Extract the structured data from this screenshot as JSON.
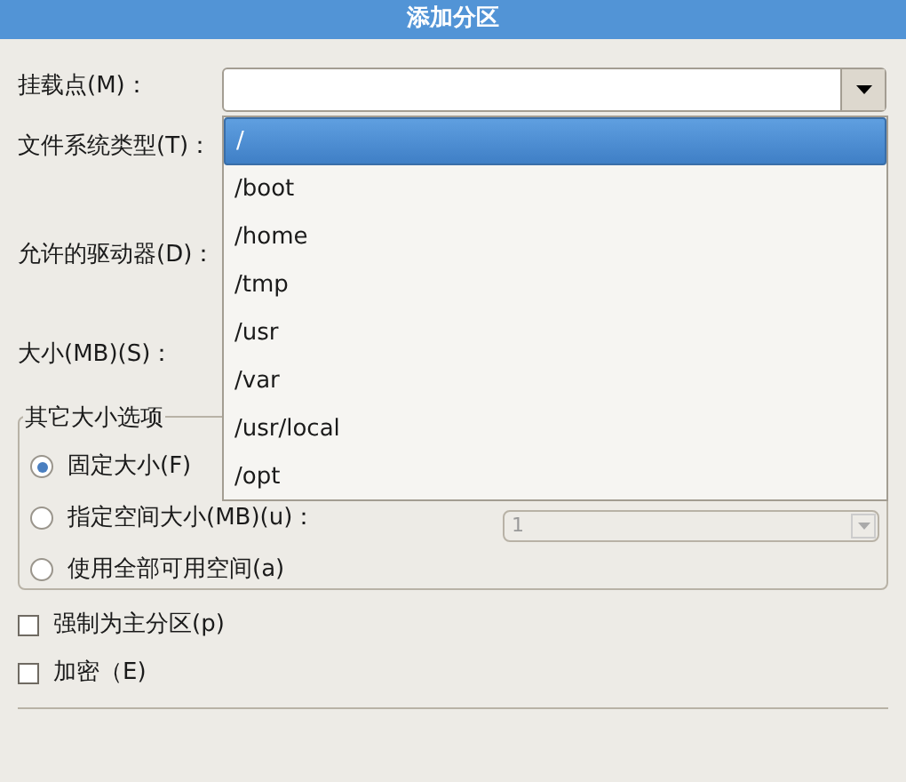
{
  "window": {
    "title": "添加分区"
  },
  "fields": [
    {
      "label": "挂载点(M)："
    },
    {
      "label": "文件系统类型(T)："
    },
    {
      "label": "允许的驱动器(D)："
    },
    {
      "label": "大小(MB)(S)："
    }
  ],
  "mount_dropdown": {
    "expanded": true,
    "options": [
      {
        "label": "/",
        "selected": true
      },
      {
        "label": "/boot",
        "selected": false
      },
      {
        "label": "/home",
        "selected": false
      },
      {
        "label": "/tmp",
        "selected": false
      },
      {
        "label": "/usr",
        "selected": false
      },
      {
        "label": "/var",
        "selected": false
      },
      {
        "label": "/usr/local",
        "selected": false
      },
      {
        "label": "/opt",
        "selected": false
      }
    ]
  },
  "size_options": {
    "title": "其它大小选项",
    "options": [
      {
        "label": "固定大小(F)",
        "selected": true
      },
      {
        "label": "指定空间大小(MB)(u)：",
        "selected": false
      },
      {
        "label": "使用全部可用空间(a)",
        "selected": false
      }
    ],
    "max_size": {
      "value": "1",
      "disabled": true
    }
  },
  "checkboxes": [
    {
      "label": "强制为主分区(p)",
      "checked": false
    },
    {
      "label": "加密（E)",
      "checked": false
    }
  ]
}
